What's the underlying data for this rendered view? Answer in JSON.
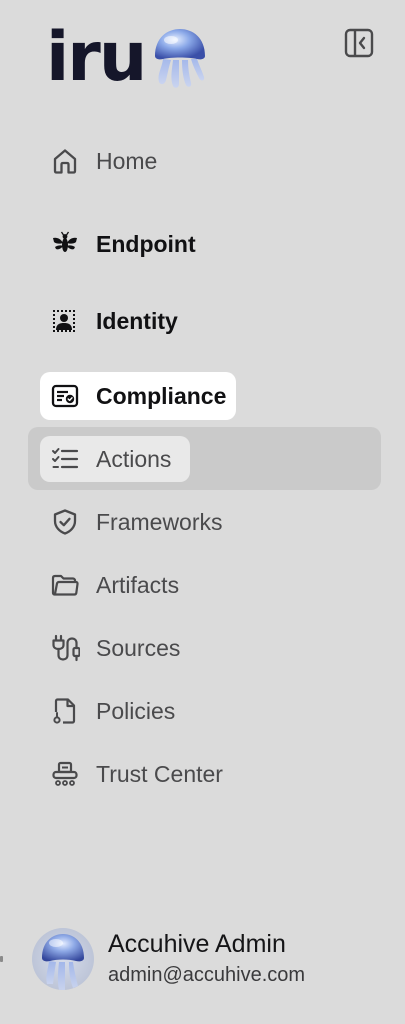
{
  "brand": {
    "logo_text": "iru",
    "mark_icon": "jellyfish-logo-icon"
  },
  "header": {
    "collapse_icon": "sidebar-collapse-icon"
  },
  "nav": {
    "home": {
      "label": "Home",
      "icon": "home-icon"
    },
    "endpoint": {
      "label": "Endpoint",
      "icon": "bee-icon"
    },
    "identity": {
      "label": "Identity",
      "icon": "identity-icon"
    },
    "compliance": {
      "label": "Compliance",
      "icon": "compliance-icon"
    },
    "actions": {
      "label": "Actions",
      "icon": "checklist-icon"
    },
    "frameworks": {
      "label": "Frameworks",
      "icon": "shield-check-icon"
    },
    "artifacts": {
      "label": "Artifacts",
      "icon": "folder-icon"
    },
    "sources": {
      "label": "Sources",
      "icon": "plug-icon"
    },
    "policies": {
      "label": "Policies",
      "icon": "document-icon"
    },
    "trust_center": {
      "label": "Trust Center",
      "icon": "trust-center-icon"
    }
  },
  "user": {
    "name": "Accuhive Admin",
    "email": "admin@accuhive.com",
    "avatar_icon": "jellyfish-avatar"
  },
  "colors": {
    "background": "#dbdbdb",
    "active_item": "#ffffff",
    "section_highlight": "#cacaca",
    "logo_text": "#15162a"
  }
}
